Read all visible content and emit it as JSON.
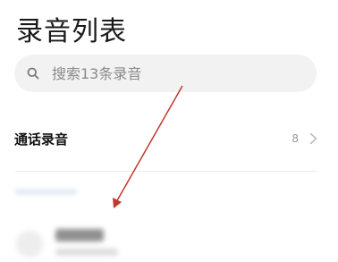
{
  "header": {
    "title": "录音列表"
  },
  "search": {
    "placeholder": "搜索13条录音",
    "icon": "search-icon"
  },
  "call_recordings": {
    "label": "通话录音",
    "count": "8",
    "icon": "chevron-right-icon"
  },
  "colors": {
    "background": "#ffffff",
    "search_bg": "#f2f2f2",
    "arrow": "#c0392b"
  }
}
